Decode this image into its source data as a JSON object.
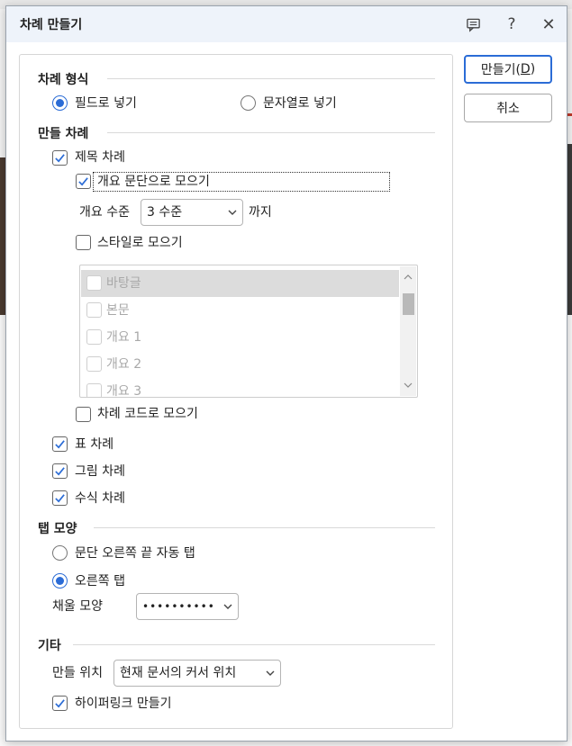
{
  "dialog": {
    "title": "차례 만들기",
    "comment_icon": "comment-icon",
    "help_label": "?",
    "close_label": "✕"
  },
  "buttons": {
    "create_label": "만들기(",
    "create_accel": "D",
    "create_close": ")",
    "cancel_label": "취소"
  },
  "format": {
    "title": "차례 형식",
    "options": [
      "필드로 넣기",
      "문자열로 넣기"
    ],
    "selected": "필드로 넣기"
  },
  "make": {
    "title": "만들 차례",
    "heading_toc": {
      "label": "제목 차례",
      "checked": true
    },
    "outline_collect": {
      "label": "개요 문단으로 모으기",
      "checked": true
    },
    "outline_level": {
      "label": "개요 수준",
      "value": "3 수준",
      "suffix": "까지"
    },
    "style_collect": {
      "label": "스타일로 모으기",
      "checked": false
    },
    "style_list": [
      "바탕글",
      "본문",
      "개요 1",
      "개요 2",
      "개요 3"
    ],
    "code_collect": {
      "label": "차례 코드로 모으기",
      "checked": false
    },
    "table_toc": {
      "label": "표 차례",
      "checked": true
    },
    "figure_toc": {
      "label": "그림 차례",
      "checked": true
    },
    "equation_toc": {
      "label": "수식 차례",
      "checked": true
    }
  },
  "tab": {
    "title": "탭 모양",
    "options": [
      "문단 오른쪽 끝 자동 탭",
      "오른쪽 탭"
    ],
    "selected": "오른쪽 탭",
    "fill_label": "채울 모양",
    "fill_value": "••••••••••"
  },
  "etc": {
    "title": "기타",
    "position_label": "만들 위치",
    "position_value": "현재 문서의 커서 위치",
    "hyperlink": {
      "label": "하이퍼링크 만들기",
      "checked": true
    }
  },
  "colors": {
    "accent": "#2b6cd6",
    "titlebar": "#eef3fa"
  }
}
